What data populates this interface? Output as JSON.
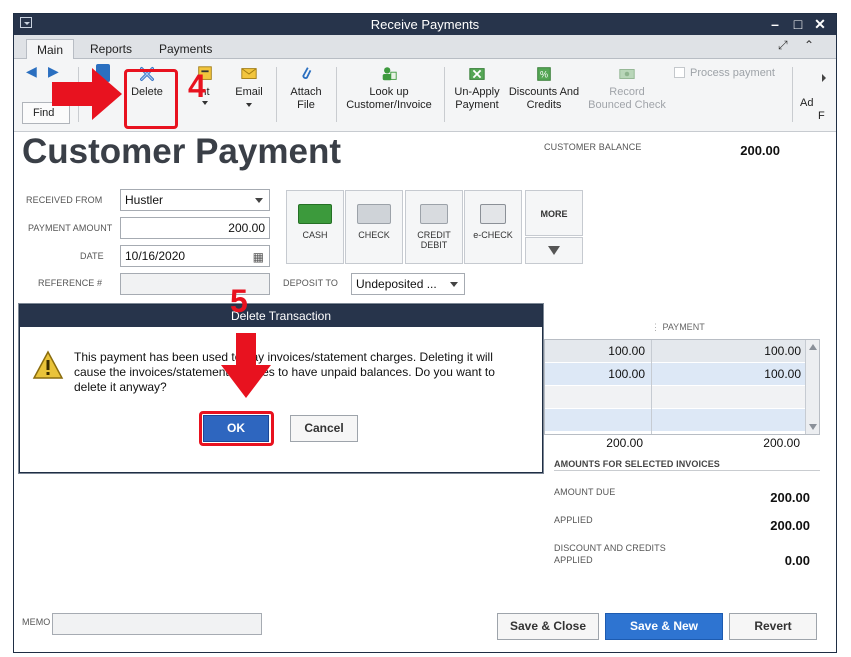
{
  "window": {
    "title": "Receive Payments"
  },
  "tabs": [
    {
      "label": "Main"
    },
    {
      "label": "Reports"
    },
    {
      "label": "Payments"
    }
  ],
  "toolbar": {
    "find_label": "Find",
    "delete_label": "Delete",
    "print_label": "nt",
    "email_label": "Email",
    "attach_label_1": "Attach",
    "attach_label_2": "File",
    "lookup_label_1": "Look up",
    "lookup_label_2": "Customer/Invoice",
    "unapply_label_1": "Un-Apply",
    "unapply_label_2": "Payment",
    "discounts_label_1": "Discounts And",
    "discounts_label_2": "Credits",
    "record_label_1": "Record",
    "record_label_2": "Bounced Check",
    "process_payment_label": "Process payment",
    "overflow_label_1": "Ad",
    "overflow_label_2": "F"
  },
  "form": {
    "heading": "Customer Payment",
    "customer_balance_label": "CUSTOMER BALANCE",
    "customer_balance_value": "200.00",
    "received_from_label": "RECEIVED FROM",
    "received_from_value": "Hustler",
    "payment_amount_label": "PAYMENT AMOUNT",
    "payment_amount_value": "200.00",
    "date_label": "DATE",
    "date_value": "10/16/2020",
    "reference_label": "REFERENCE #",
    "deposit_to_label": "DEPOSIT TO",
    "deposit_to_value": "Undeposited ..."
  },
  "payment_methods": [
    {
      "label": "CASH"
    },
    {
      "label": "CHECK"
    },
    {
      "label_1": "CREDIT",
      "label_2": "DEBIT"
    },
    {
      "label": "e-CHECK"
    },
    {
      "label": "MORE"
    }
  ],
  "grid": {
    "payment_header": "PAYMENT",
    "rows": [
      {
        "amount": "100.00",
        "payment": "100.00"
      },
      {
        "amount": "100.00",
        "payment": "100.00"
      }
    ],
    "total_amount": "200.00",
    "total_payment": "200.00"
  },
  "summary": {
    "title": "AMOUNTS FOR SELECTED INVOICES",
    "amount_due_label": "AMOUNT DUE",
    "amount_due_value": "200.00",
    "applied_label": "APPLIED",
    "applied_value": "200.00",
    "discount_label_1": "DISCOUNT AND CREDITS",
    "discount_label_2": "APPLIED",
    "discount_value": "0.00"
  },
  "memo_label": "MEMO",
  "buttons": {
    "save_close": "Save & Close",
    "save_new": "Save & New",
    "revert": "Revert"
  },
  "dialog": {
    "title": "Delete Transaction",
    "message": "This payment has been used to pay invoices/statement charges.  Deleting it will cause the invoices/statement charges to have unpaid balances.  Do you want to delete it anyway?",
    "ok_label": "OK",
    "cancel_label": "Cancel"
  },
  "annotations": {
    "step_4": "4",
    "step_5": "5"
  },
  "colors": {
    "titlebar": "#27344b",
    "primary_button": "#2e74d1",
    "annotation_red": "#e8121f",
    "grid_selected_row": "#dde8f6"
  }
}
